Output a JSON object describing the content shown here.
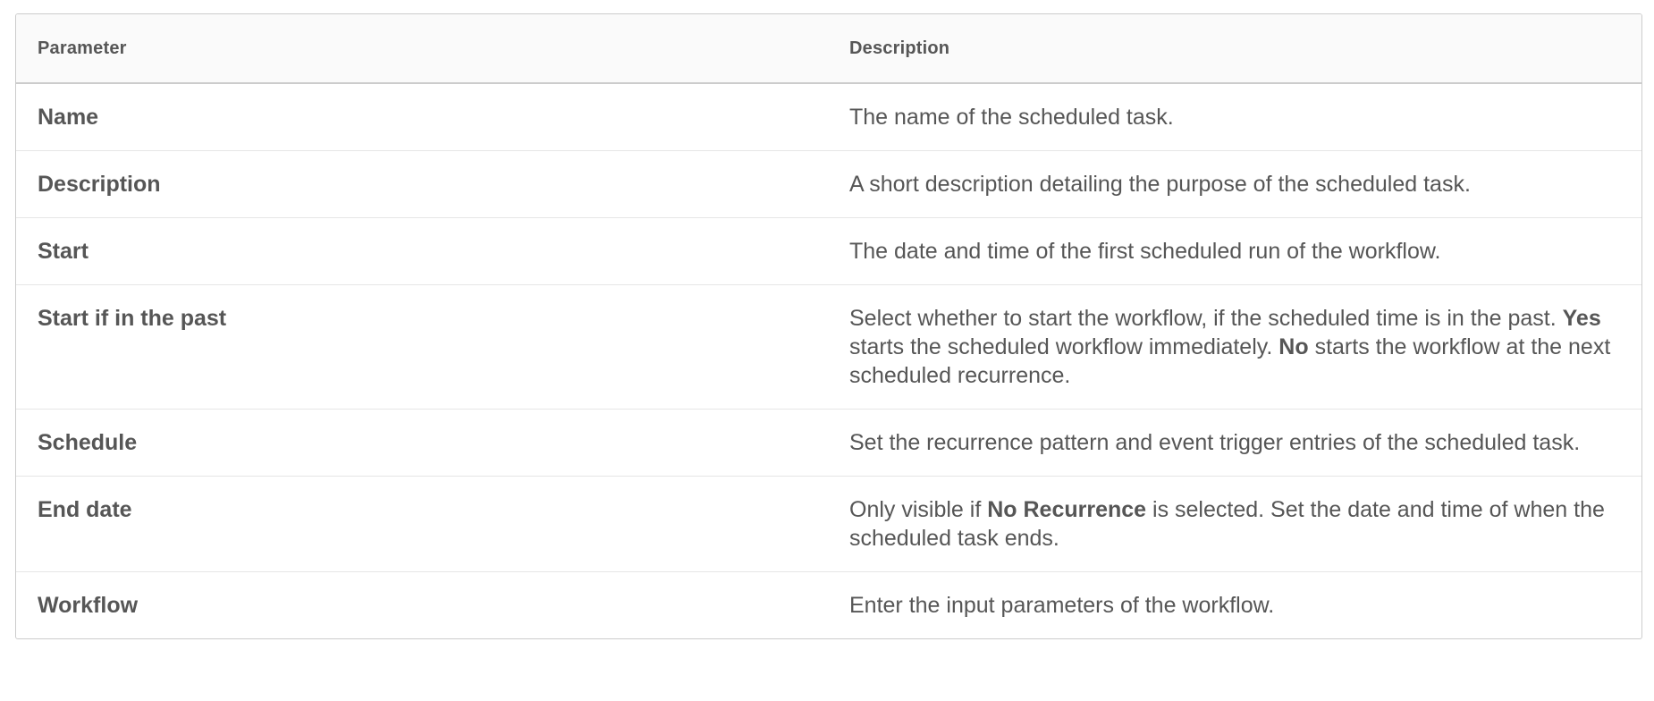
{
  "table": {
    "headers": [
      "Parameter",
      "Description"
    ],
    "rows": [
      {
        "param": "Name",
        "desc": [
          {
            "t": "The name of the scheduled task."
          }
        ]
      },
      {
        "param": "Description",
        "desc": [
          {
            "t": "A short description detailing the purpose of the scheduled task."
          }
        ]
      },
      {
        "param": "Start",
        "desc": [
          {
            "t": "The date and time of the first scheduled run of the workflow."
          }
        ]
      },
      {
        "param": "Start if in the past",
        "desc": [
          {
            "t": "Select whether to start the workflow, if the scheduled time is in the past. "
          },
          {
            "t": "Yes",
            "b": true
          },
          {
            "t": " starts the scheduled workflow immediately. "
          },
          {
            "t": "No",
            "b": true
          },
          {
            "t": " starts the workflow at the next scheduled recurrence."
          }
        ]
      },
      {
        "param": "Schedule",
        "desc": [
          {
            "t": "Set the recurrence pattern and event trigger entries of the scheduled task."
          }
        ]
      },
      {
        "param": "End date",
        "desc": [
          {
            "t": "Only visible if "
          },
          {
            "t": "No Recurrence",
            "b": true
          },
          {
            "t": " is selected. Set the date and time of when the scheduled task ends."
          }
        ]
      },
      {
        "param": "Workflow",
        "desc": [
          {
            "t": "Enter the input parameters of the workflow."
          }
        ]
      }
    ]
  }
}
